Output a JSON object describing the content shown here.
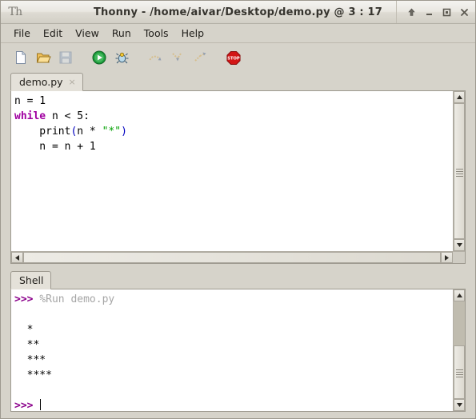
{
  "window": {
    "logo_text": "Th",
    "title": "Thonny  -  /home/aivar/Desktop/demo.py  @  3 : 17",
    "controls": [
      {
        "name": "always-on-top",
        "label": "↑"
      },
      {
        "name": "minimize",
        "label": "–"
      },
      {
        "name": "maximize",
        "label": "□"
      },
      {
        "name": "close",
        "label": "✕"
      }
    ]
  },
  "menubar": {
    "items": [
      {
        "label": "File"
      },
      {
        "label": "Edit"
      },
      {
        "label": "View"
      },
      {
        "label": "Run"
      },
      {
        "label": "Tools"
      },
      {
        "label": "Help"
      }
    ]
  },
  "toolbar": {
    "buttons": [
      {
        "name": "new-file-icon",
        "label": "New",
        "enabled": true
      },
      {
        "name": "open-file-icon",
        "label": "Load",
        "enabled": true
      },
      {
        "name": "save-file-icon",
        "label": "Save",
        "enabled": false
      },
      {
        "name": "run-icon",
        "label": "Run",
        "enabled": true
      },
      {
        "name": "debug-icon",
        "label": "Debug",
        "enabled": true
      },
      {
        "name": "step-over-icon",
        "label": "Step over",
        "enabled": false
      },
      {
        "name": "step-into-icon",
        "label": "Step into",
        "enabled": false
      },
      {
        "name": "step-out-icon",
        "label": "Step out",
        "enabled": false
      },
      {
        "name": "stop-icon",
        "label": "Stop",
        "enabled": true
      }
    ]
  },
  "editor": {
    "tab_label": "demo.py",
    "tab_close": "×",
    "code_lines": [
      [
        {
          "t": "n = 1",
          "c": "plain"
        }
      ],
      [
        {
          "t": "while",
          "c": "kw"
        },
        {
          "t": " n < 5:",
          "c": "plain"
        }
      ],
      [
        {
          "t": "    print",
          "c": "plain"
        },
        {
          "t": "(",
          "c": "paren"
        },
        {
          "t": "n * ",
          "c": "plain"
        },
        {
          "t": "\"*\"",
          "c": "str"
        },
        {
          "t": ")",
          "c": "paren"
        }
      ],
      [
        {
          "t": "    n = n + 1",
          "c": "plain"
        }
      ]
    ]
  },
  "shell": {
    "tab_label": "Shell",
    "lines": [
      [
        {
          "t": ">>> ",
          "c": "prompt"
        },
        {
          "t": "%Run demo.py",
          "c": "stdcmd"
        }
      ],
      [
        {
          "t": "",
          "c": "plain"
        }
      ],
      [
        {
          "t": "  *",
          "c": "plain"
        }
      ],
      [
        {
          "t": "  **",
          "c": "plain"
        }
      ],
      [
        {
          "t": "  ***",
          "c": "plain"
        }
      ],
      [
        {
          "t": "  ****",
          "c": "plain"
        }
      ],
      [
        {
          "t": "",
          "c": "plain"
        }
      ],
      [
        {
          "t": ">>> ",
          "c": "prompt"
        }
      ]
    ]
  },
  "colors": {
    "chrome": "#d6d3ca",
    "keyword": "#a000a0",
    "string": "#00a000",
    "paren": "#0000c0",
    "prompt": "#8b008b",
    "command": "#a6a6a6"
  }
}
